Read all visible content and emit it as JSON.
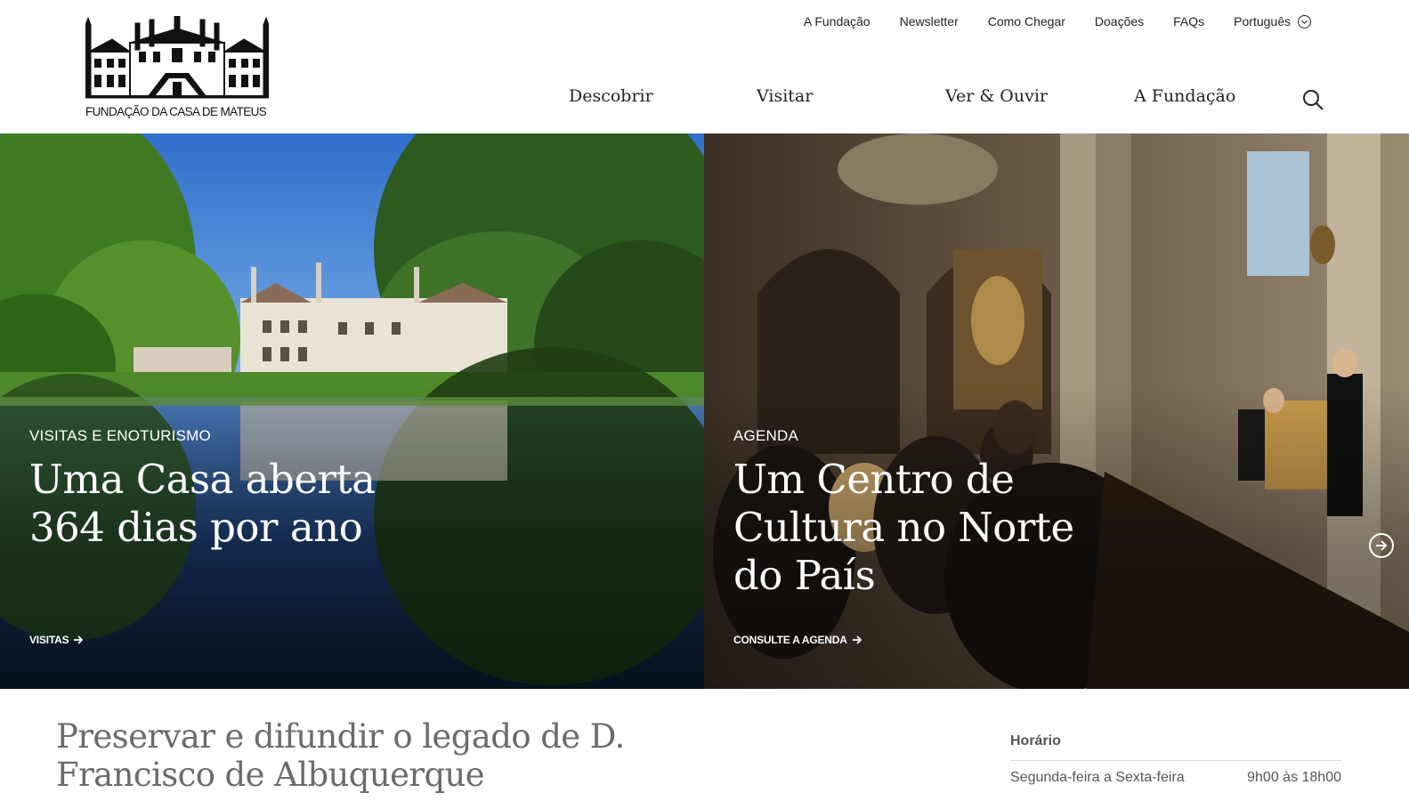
{
  "brand": {
    "logo_text": "FUNDAÇÃO DA CASA DE MATEUS"
  },
  "top_nav": {
    "items": [
      "A Fundação",
      "Newsletter",
      "Como Chegar",
      "Doações",
      "FAQs"
    ],
    "language": "Português"
  },
  "main_nav": {
    "items": [
      "Descobrir",
      "Visitar",
      "Ver & Ouvir",
      "A Fundação"
    ]
  },
  "hero": {
    "panels": [
      {
        "eyebrow": "VISITAS E ENOTURISMO",
        "title": "Uma Casa aberta 364 dias por ano",
        "cta": "VISITAS"
      },
      {
        "eyebrow": "AGENDA",
        "title": "Um Centro de Cultura no Norte do País",
        "cta": "CONSULTE A AGENDA"
      }
    ]
  },
  "intro": {
    "title": "Preservar e difundir o legado de D. Francisco de Albuquerque"
  },
  "hours": {
    "title": "Horário",
    "rows": [
      {
        "label": "Segunda-feira a Sexta-feira",
        "value": "9h00 às 18h00"
      }
    ]
  }
}
